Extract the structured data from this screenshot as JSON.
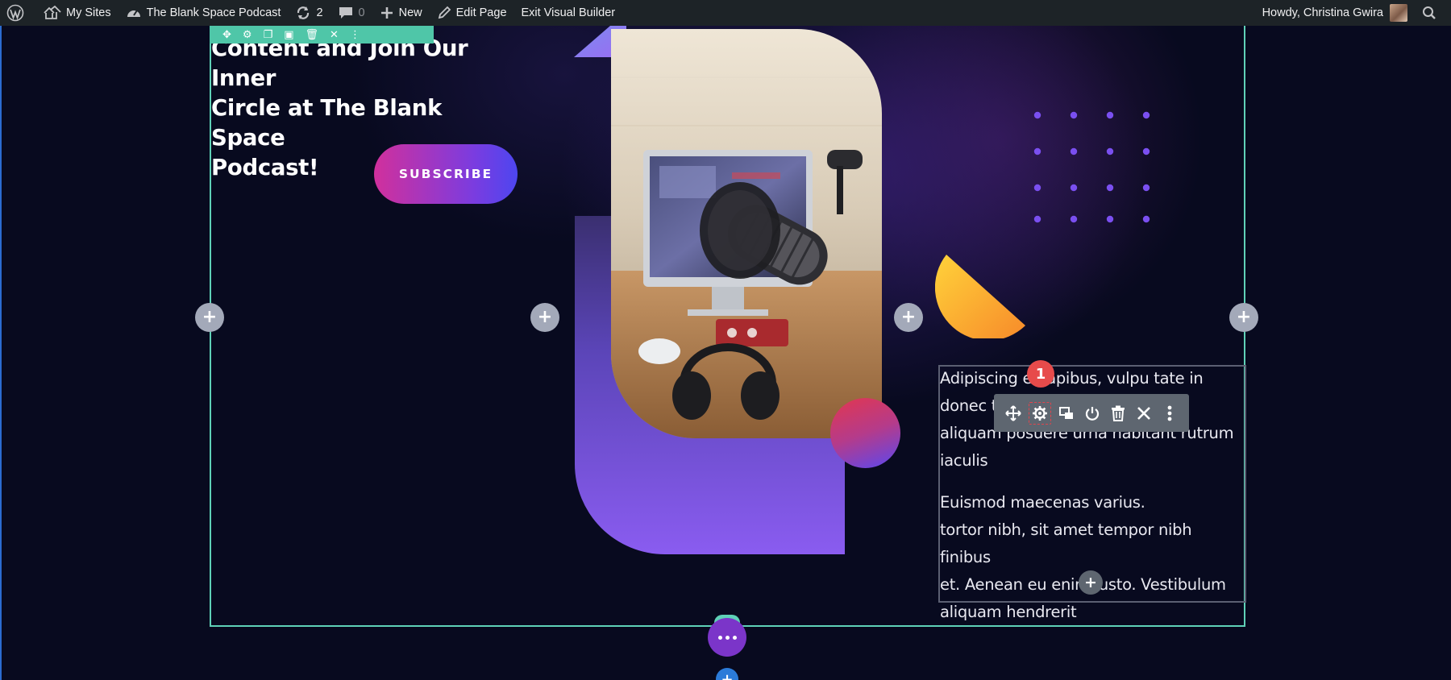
{
  "adminbar": {
    "my_sites": "My Sites",
    "site_name": "The Blank Space Podcast",
    "updates_count": "2",
    "comments_count": "0",
    "new_label": "New",
    "edit_page": "Edit Page",
    "exit_builder": "Exit Visual Builder",
    "greeting": "Howdy, Christina Gwira"
  },
  "hero": {
    "headline": "Content and Join Our Inner\nCircle at The Blank Space\nPodcast!",
    "subscribe_label": "SUBSCRIBE"
  },
  "text_module": {
    "paragraph1": "Adipiscing e        dapibus, vulpu tate in\ndonec t                                  erat,\naliquam posuere urna habitant rutrum\niaculis",
    "paragraph2": "Euismod maecenas varius.\ntortor nibh, sit amet tempor nibh finibus\net. Aenean eu enim justo. Vestibulum\naliquam hendrerit"
  },
  "module_toolbar": {
    "tools": [
      "move-icon",
      "settings-icon",
      "duplicate-icon",
      "disable-icon",
      "delete-icon",
      "close-icon",
      "more-icon"
    ]
  },
  "annotation": {
    "step_badge": "1"
  },
  "colors": {
    "admin_bar": "#1d2327",
    "row_outline": "#5fd1b7",
    "badge": "#e74b4b",
    "module_toolbar": "#5e6670",
    "row_settings": "#7b35c9"
  }
}
